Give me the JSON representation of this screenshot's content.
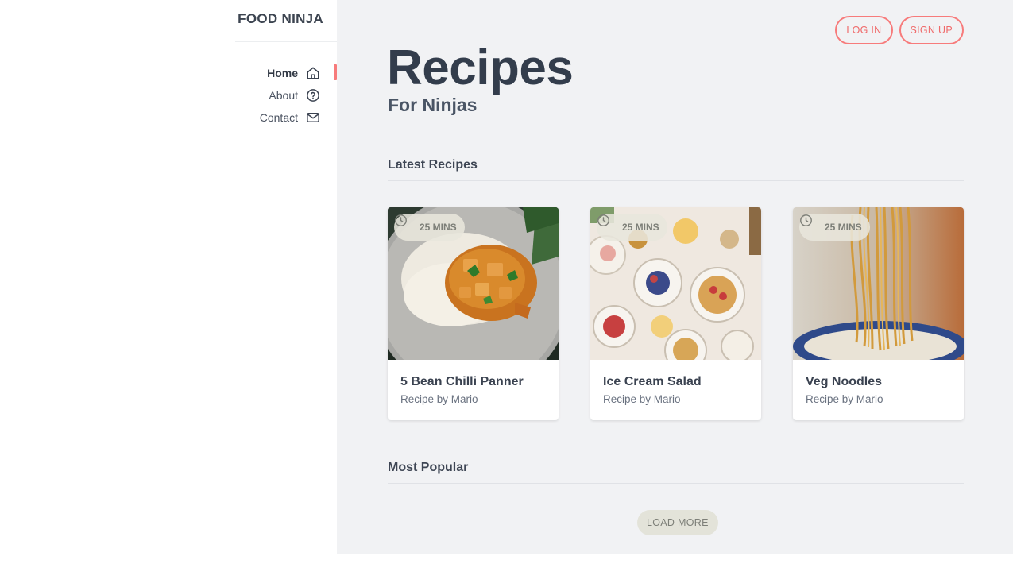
{
  "brand": "FOOD NINJA",
  "nav": {
    "items": [
      {
        "label": "Home",
        "icon": "home-icon",
        "active": true
      },
      {
        "label": "About",
        "icon": "help-circle-icon",
        "active": false
      },
      {
        "label": "Contact",
        "icon": "mail-icon",
        "active": false
      }
    ]
  },
  "auth": {
    "login_label": "LOG IN",
    "signup_label": "SIGN UP"
  },
  "hero": {
    "title": "Recipes",
    "subtitle": "For Ninjas"
  },
  "sections": {
    "latest": "Latest Recipes",
    "popular": "Most Popular"
  },
  "recipes": [
    {
      "title": "5 Bean Chilli Panner",
      "author": "Recipe by Mario",
      "time": "25 MINS",
      "image": "curry-rice-dish"
    },
    {
      "title": "Ice Cream Salad",
      "author": "Recipe by Mario",
      "time": "25 MINS",
      "image": "waffles-and-fruit-table"
    },
    {
      "title": "Veg Noodles",
      "author": "Recipe by Mario",
      "time": "25 MINS",
      "image": "noodles-lifted-bowl"
    }
  ],
  "load_more_label": "LOAD MORE",
  "colors": {
    "accent": "#f77b7b",
    "background": "#f1f2f4",
    "text": "#333d4c",
    "badge": "#e3e3d9"
  }
}
